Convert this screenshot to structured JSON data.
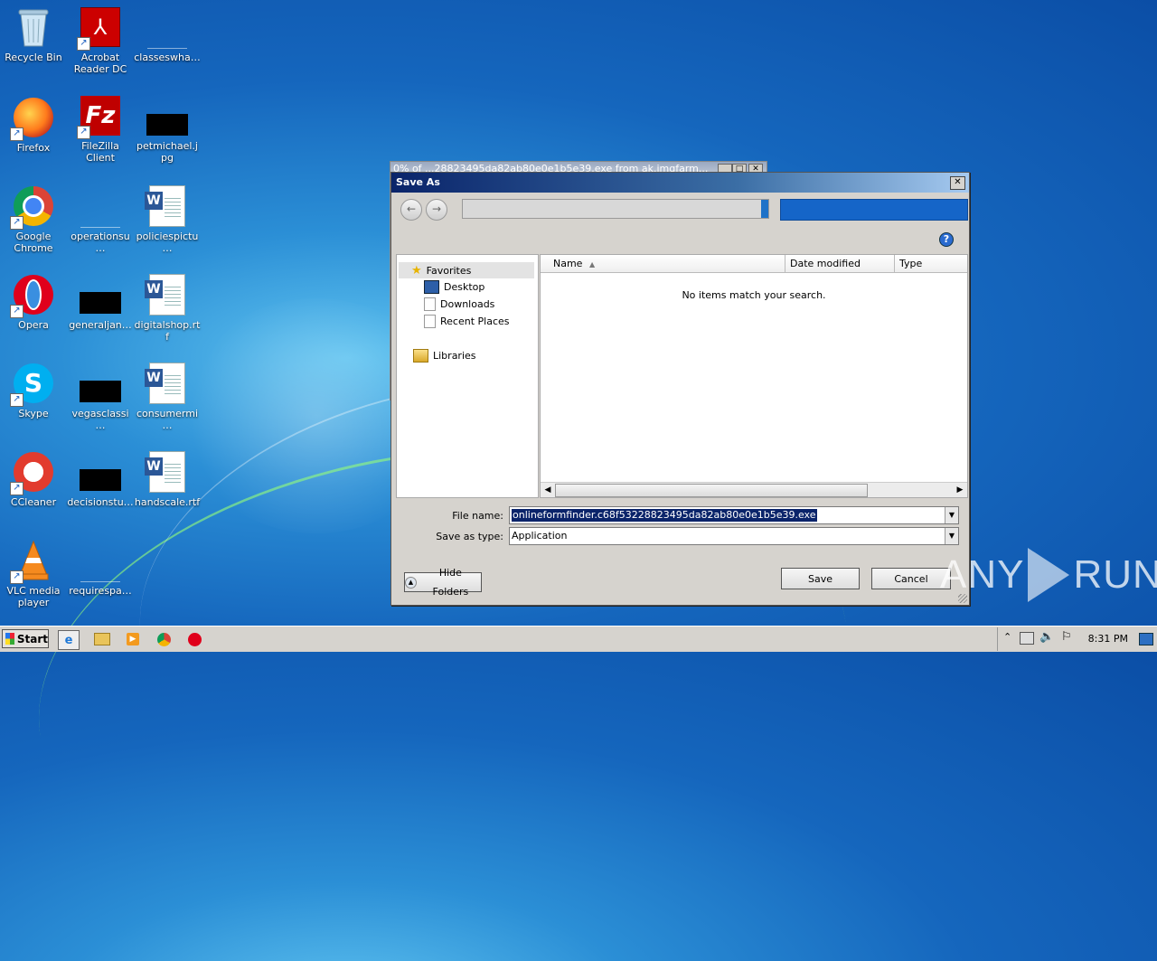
{
  "desktop": {
    "icons": [
      {
        "label": "Recycle Bin",
        "icon": "recycle-bin-icon"
      },
      {
        "label": "Acrobat Reader DC",
        "icon": "acrobat-icon"
      },
      {
        "label": "classeswha…",
        "icon": "file-icon"
      },
      {
        "label": "Firefox",
        "icon": "firefox-icon"
      },
      {
        "label": "FileZilla Client",
        "icon": "filezilla-icon"
      },
      {
        "label": "petmichael.jpg",
        "icon": "image-file-icon"
      },
      {
        "label": "Google Chrome",
        "icon": "chrome-icon"
      },
      {
        "label": "operationsu…",
        "icon": "file-icon"
      },
      {
        "label": "policiespictu…",
        "icon": "word-document-icon"
      },
      {
        "label": "Opera",
        "icon": "opera-icon"
      },
      {
        "label": "generaljan…",
        "icon": "file-icon"
      },
      {
        "label": "digitalshop.rtf",
        "icon": "word-document-icon"
      },
      {
        "label": "Skype",
        "icon": "skype-icon"
      },
      {
        "label": "vegasclassi…",
        "icon": "file-icon"
      },
      {
        "label": "consumermi…",
        "icon": "word-document-icon"
      },
      {
        "label": "CCleaner",
        "icon": "ccleaner-icon"
      },
      {
        "label": "decisionstu…",
        "icon": "file-icon"
      },
      {
        "label": "handscale.rtf",
        "icon": "word-document-icon"
      },
      {
        "label": "VLC media player",
        "icon": "vlc-icon"
      },
      {
        "label": "requirespa…",
        "icon": "file-icon"
      }
    ]
  },
  "bg_window": {
    "title": "0% of ...28823495da82ab80e0e1b5e39.exe from ak.imgfarm..."
  },
  "save_dialog": {
    "title": "Save As",
    "nav": {
      "favorites": "Favorites",
      "desktop": "Desktop",
      "downloads": "Downloads",
      "recent": "Recent Places",
      "libraries": "Libraries"
    },
    "columns": {
      "name": "Name",
      "date": "Date modified",
      "type": "Type"
    },
    "empty_message": "No items match your search.",
    "file_name_label": "File name:",
    "file_name_value": "onlineformfinder.c68f53228823495da82ab80e0e1b5e39.exe",
    "save_type_label": "Save as type:",
    "save_type_value": "Application",
    "hide_folders": "Hide Folders",
    "save": "Save",
    "cancel": "Cancel"
  },
  "taskbar": {
    "start": "Start",
    "clock": "8:31 PM"
  },
  "watermark": {
    "left": "ANY",
    "right": "RUN"
  }
}
